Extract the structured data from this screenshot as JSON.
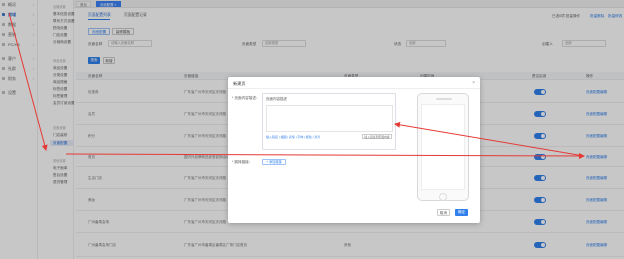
{
  "nav1": {
    "items": [
      {
        "label": "概况"
      },
      {
        "label": "商城"
      },
      {
        "label": "数据"
      },
      {
        "label": "营销"
      },
      {
        "label": "PC/H5"
      },
      {
        "label": "客户"
      },
      {
        "label": "社群"
      },
      {
        "label": "财务"
      },
      {
        "label": "设置"
      }
    ]
  },
  "nav2": {
    "groups": [
      {
        "title": "店铺设置",
        "items": [
          "基本信息设置",
          "联系方式设置",
          "物流设置",
          "门店设置",
          "分销商设置"
        ]
      },
      {
        "title": "商品设置",
        "items": [
          "商品设置",
          "分类设置",
          "商品规格",
          "标签设置",
          "标签管理",
          "会员订阅设置"
        ]
      },
      {
        "title": "页面设置",
        "items": [
          "门店装修",
          "页面配置"
        ]
      },
      {
        "title": "其他设置",
        "items": [
          "电子面单",
          "售后设置",
          "退货管理"
        ]
      }
    ]
  },
  "topbar": {
    "tabs": [
      "首页",
      "页面配置"
    ]
  },
  "main": {
    "subtabs": [
      "页面配置列表",
      "页面配置记录"
    ],
    "view_buttons": [
      "页面配置",
      "装修模板"
    ],
    "filters": {
      "name_label": "页面名称",
      "name_placeholder": "请输入页面名称",
      "type_label": "页面类型",
      "type_value": "全部类型",
      "status_label": "状态",
      "status_value": "全部",
      "creator_label": "创建人",
      "creator_value": "全部"
    },
    "top_right": {
      "text": "已选0项 批量操作",
      "link1": "批量删除",
      "link2": "批量修改"
    },
    "actions": {
      "search": "搜索",
      "add": "新增"
    },
    "columns": [
      "页面名称",
      "页面链接",
      "页面类型",
      "创建时间",
      "是否启用",
      "操作"
    ],
    "rows": [
      {
        "name": "优惠券",
        "link": "广东省广州市天河区天河路",
        "type": "",
        "time": "",
        "op": "页面配置编辑"
      },
      {
        "name": "会员",
        "link": "广东省广州市天河区天河路",
        "type": "",
        "time": "",
        "op": "页面配置编辑"
      },
      {
        "name": "积分",
        "link": "广东省广州市天河区天河路",
        "type": "",
        "time": "",
        "op": "页面配置编辑"
      },
      {
        "name": "首页",
        "link": "国内外品牌商品优惠促销活动",
        "type": "",
        "time": "",
        "op": "页面配置编辑"
      },
      {
        "name": "生活门店",
        "link": "广东省广州市天河区天河路",
        "type": "",
        "time": "",
        "op": "页面配置编辑"
      },
      {
        "name": "美妆",
        "link": "广东省广州市天河区天河路",
        "type": "",
        "time": "",
        "op": "页面配置编辑"
      },
      {
        "name": "广州番禺会场",
        "link": "广东省广州市天河区天河路",
        "type": "",
        "time": "",
        "op": "页面配置编辑"
      },
      {
        "name": "广州番禺会场门店",
        "link": "广东省广州市番禺区番禺区广场门店首页",
        "type": "其他",
        "time": "",
        "op": "页面配置编辑"
      }
    ]
  },
  "modal": {
    "title": "新建页",
    "field1_label": "* 页面内容描述：",
    "editor_title": "页面内容描述",
    "editor_tools": "插入链接 | 插图 | 表情 | 字体 | 颜色 | 对齐",
    "editor_button": "插入链接到页面内容",
    "field2_label": "* 跳转链接：",
    "add_link": "+ 添加链接",
    "cancel": "取消",
    "ok": "确定"
  },
  "colors": {
    "accent": "#2f80ed",
    "arrow": "#e53935"
  }
}
